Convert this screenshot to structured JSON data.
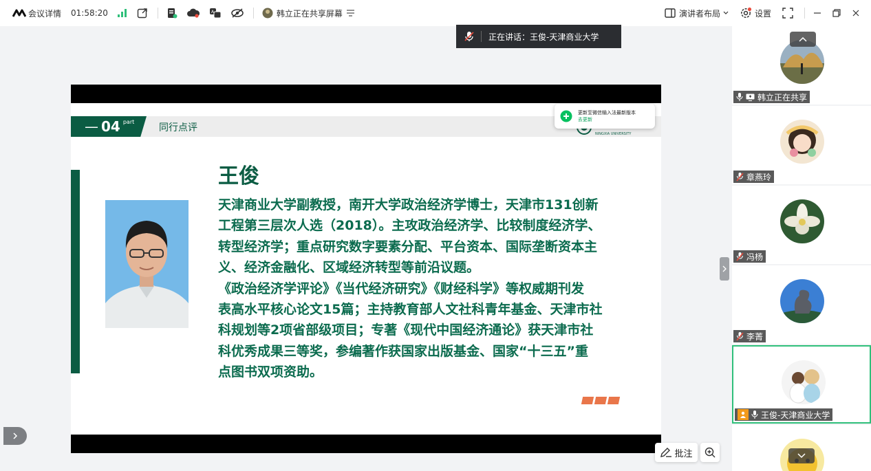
{
  "toolbar": {
    "meeting_details": "会议详情",
    "timer": "01:58:20",
    "sharing_status": "韩立正在共享屏幕",
    "layout_label": "演讲者布局",
    "settings_label": "设置"
  },
  "speaking": {
    "label": "正在讲话：",
    "speaker": "王俊-天津商业大学"
  },
  "slide": {
    "section_number": "04",
    "section_suffix": "part",
    "section_title": "同行点评",
    "name": "王俊",
    "bio_lines": [
      "天津商业大学副教授，南开大学政治经济学博士，天津市131创新",
      "工程第三层次人选（2018）。主攻政治经济学、比较制度经济学、",
      "转型经济学；重点研究数字要素分配、平台资本、国际垄断资本主",
      "义、经济金融化、区域经济转型等前沿议题。",
      "《政治经济学评论》《当代经济研究》《财经科学》等权威期刊发",
      "表高水平核心论文15篇；主持教育部人文社科青年基金、天津市社",
      "科规划等2项省部级项目；专著《现代中国经济通论》获天津市社",
      "科优秀成果三等奖，参编著作获国家出版基金、国家“十三五”重",
      "点图书双项资助。"
    ],
    "logo_caption": "NINGXIA UNIVERSITY"
  },
  "wechat_tip": {
    "text": "更新至微信输入法最新版本",
    "link": "去更新"
  },
  "controls": {
    "annotate_label": "批注"
  },
  "participants": [
    {
      "name": "韩立正在共享",
      "mic": "on",
      "sharing": true
    },
    {
      "name": "章燕玲",
      "mic": "muted"
    },
    {
      "name": "冯杨",
      "mic": "muted"
    },
    {
      "name": "李菁",
      "mic": "muted"
    },
    {
      "name": "王俊-天津商业大学",
      "mic": "on",
      "host": true,
      "active": true
    }
  ],
  "colors": {
    "slide_green": "#0b5c43",
    "signal_green": "#2fbf7a",
    "accent_orange": "#e9764a"
  }
}
